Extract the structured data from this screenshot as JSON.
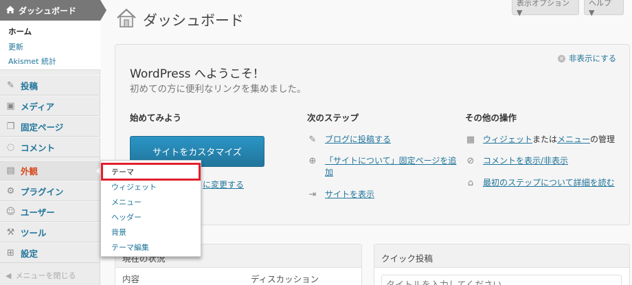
{
  "sidebar": {
    "dashboard_label": "ダッシュボード",
    "submenu": {
      "home": "ホーム",
      "updates": "更新",
      "akismet": "Akismet 統計"
    },
    "items": [
      {
        "label": "投稿",
        "icon": "pin-icon"
      },
      {
        "label": "メディア",
        "icon": "media-icon"
      },
      {
        "label": "固定ページ",
        "icon": "pages-icon"
      },
      {
        "label": "コメント",
        "icon": "comment-icon"
      },
      {
        "label": "外観",
        "icon": "appearance-icon",
        "active": true
      },
      {
        "label": "プラグイン",
        "icon": "plugin-icon"
      },
      {
        "label": "ユーザー",
        "icon": "users-icon"
      },
      {
        "label": "ツール",
        "icon": "tools-icon"
      },
      {
        "label": "設定",
        "icon": "settings-icon"
      }
    ],
    "collapse_label": "メニューを閉じる"
  },
  "flyout": {
    "items": [
      "テーマ",
      "ウィジェット",
      "メニュー",
      "ヘッダー",
      "背景",
      "テーマ編集"
    ]
  },
  "header": {
    "title": "ダッシュボード",
    "screen_options": "表示オプション ▼",
    "help": "ヘルプ ▼"
  },
  "welcome": {
    "dismiss": "非表示にする",
    "title": "WordPress へようこそ！",
    "subtitle": "初めての方に便利なリンクを集めました。",
    "col1": {
      "heading": "始めてみよう",
      "button": "サイトをカスタマイズ",
      "link": "に変更する"
    },
    "col2": {
      "heading": "次のステップ",
      "items": [
        {
          "link": "ブログに投稿する",
          "rest": ""
        },
        {
          "link": "「サイトについて」固定ページを追加",
          "rest": ""
        },
        {
          "link": "サイトを表示",
          "rest": ""
        }
      ]
    },
    "col3": {
      "heading": "その他の操作",
      "manage": {
        "link1": "ウィジェット",
        "mid": "または",
        "link2": "メニュー",
        "end": "の管理"
      },
      "comments_link": "コメントを表示/非表示",
      "learn_link": "最初のステップについて詳細を読む"
    }
  },
  "status_box": {
    "title": "現在の状況",
    "col_content": "内容",
    "col_discussion": "ディスカッション"
  },
  "quickpost": {
    "title": "クイック投稿",
    "placeholder": "タイトルを入力してください"
  },
  "colors": {
    "accent": "#21759b",
    "active": "#d54e21",
    "highlight": "#e0202b",
    "button": "#2a95c5"
  }
}
